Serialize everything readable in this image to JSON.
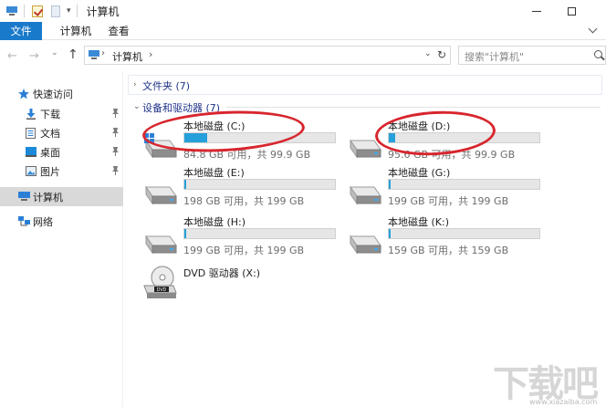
{
  "window": {
    "title": "计算机",
    "quick_access_dropdown": "▾"
  },
  "ribbon": {
    "tabs": [
      "文件",
      "计算机",
      "查看"
    ]
  },
  "nav": {
    "back": "←",
    "forward": "→",
    "recent": "⌄",
    "up": "↑",
    "address_text": "计算机",
    "address_sep": "›",
    "address_dropdown": "⌄",
    "refresh": "↻",
    "search_placeholder": "搜索\"计算机\""
  },
  "sidebar": {
    "quick_access": "快速访问",
    "items": [
      {
        "label": "下载",
        "pinned": true
      },
      {
        "label": "文档",
        "pinned": true
      },
      {
        "label": "桌面",
        "pinned": true
      },
      {
        "label": "图片",
        "pinned": true
      }
    ],
    "this_pc": "计算机",
    "network": "网络",
    "pin_glyph": "📌"
  },
  "content": {
    "folders_group": "文件夹 (7)",
    "devices_group": "设备和驱动器 (7)",
    "drives": [
      {
        "name": "本地磁盘 (C:)",
        "size_text": "84.8 GB 可用，共 99.9 GB",
        "used_fraction": 0.15
      },
      {
        "name": "本地磁盘 (D:)",
        "size_text": "95.6 GB 可用，共 99.9 GB",
        "used_fraction": 0.04
      },
      {
        "name": "本地磁盘 (E:)",
        "size_text": "198 GB 可用，共 199 GB",
        "used_fraction": 0.01
      },
      {
        "name": "本地磁盘 (G:)",
        "size_text": "199 GB 可用，共 199 GB",
        "used_fraction": 0.01
      },
      {
        "name": "本地磁盘 (H:)",
        "size_text": "199 GB 可用，共 199 GB",
        "used_fraction": 0.01
      },
      {
        "name": "本地磁盘 (K:)",
        "size_text": "159 GB 可用，共 159 GB",
        "used_fraction": 0.01
      }
    ],
    "dvd": {
      "name": "DVD 驱动器 (X:)",
      "label": "DVD"
    }
  },
  "watermark": {
    "text": "下载吧",
    "sub": "www.xiazaiba.com"
  },
  "colors": {
    "accent": "#1979ca",
    "bar_fill": "#26a0da",
    "annotation": "#d8262e"
  }
}
